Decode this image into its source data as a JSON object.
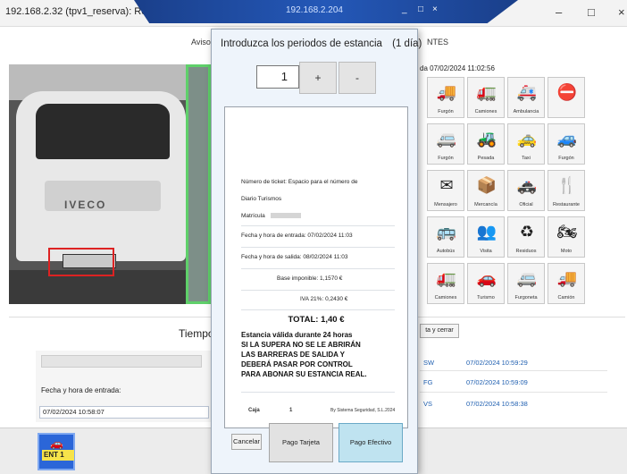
{
  "window": {
    "title": "192.168.2.32 (tpv1_reserva): Re...",
    "remote_ip": "192.168.2.204",
    "remote_min": "_",
    "remote_max": "□",
    "remote_close": "×",
    "min_btn": "–",
    "max_btn": "□",
    "close_btn": "×"
  },
  "top_labels": {
    "aviso": "Aviso",
    "cintes": "NTES"
  },
  "camera": {
    "brand": "IVECO"
  },
  "grid": {
    "date": "da 07/02/2024 11:02:56",
    "buttons": [
      {
        "label": "Furgón",
        "icon": "🚚"
      },
      {
        "label": "Camiones",
        "icon": "🚛"
      },
      {
        "label": "Ambulancia",
        "icon": "🚑"
      },
      {
        "label": "",
        "icon": "⛔"
      },
      {
        "label": "Furgón",
        "icon": "🚐"
      },
      {
        "label": "Pesada",
        "icon": "🚜"
      },
      {
        "label": "Taxi",
        "icon": "🚕"
      },
      {
        "label": "Furgón",
        "icon": "🚙"
      },
      {
        "label": "Mensajero",
        "icon": "✉"
      },
      {
        "label": "Mercancía",
        "icon": "📦"
      },
      {
        "label": "Oficial",
        "icon": "🚓"
      },
      {
        "label": "Restaurante",
        "icon": "🍴"
      },
      {
        "label": "Autobús",
        "icon": "🚌"
      },
      {
        "label": "Visita",
        "icon": "👥"
      },
      {
        "label": "Residuos",
        "icon": "♻"
      },
      {
        "label": "Moto",
        "icon": "🏍"
      },
      {
        "label": "Camiones",
        "icon": "🚛"
      },
      {
        "label": "Turismo",
        "icon": "🚗"
      },
      {
        "label": "Furgoneta",
        "icon": "🚐"
      },
      {
        "label": "Camión",
        "icon": "🚚"
      }
    ]
  },
  "tiempo_label": "Tiempo",
  "cerrar_label": "ta y cerrar",
  "bottom_left": {
    "blur_field": "",
    "entrada_label": "Fecha y hora de entrada:",
    "entrada_value": "07/02/2024 10:58:07"
  },
  "records": [
    {
      "code": "SW",
      "time": "07/02/2024 10:59:29"
    },
    {
      "code": "FG",
      "time": "07/02/2024 10:59:09"
    },
    {
      "code": "VS",
      "time": "07/02/2024 10:58:38"
    }
  ],
  "ent_button": {
    "label": "ENT 1",
    "sub": ""
  },
  "modal": {
    "heading": "Introduzca los periodos de estancia",
    "days": "(1 día)",
    "quantity": "1",
    "plus": "+",
    "minus": "-",
    "ticket": {
      "numero": "Número de ticket:  Espacio para el número de",
      "tipo": "Diario Turismos",
      "matricula": "Matrícula",
      "entrada": "Fecha y hora de entrada:   07/02/2024 11:03",
      "salida": "Fecha y hora de salida:   08/02/2024 11:03",
      "base": "Base imponible:  1,1570 €",
      "iva": "IVA 21%:  0,2430 €",
      "total": "TOTAL: 1,40 €",
      "warn1": "Estancia válida durante 24 horas",
      "warn2": "SI LA SUPERA NO SE LE ABRIRÁN",
      "warn3": "LAS BARRERAS DE SALIDA Y",
      "warn4": "DEBERÁ PASAR POR CONTROL",
      "warn5": "PARA ABONAR SU ESTANCIA REAL.",
      "caja": "Caja",
      "caja_num": "1",
      "footer_right": "By Sistema Seguridad, S.L.2024"
    },
    "cancel": "Cancelar",
    "tarjeta": "Pago Tarjeta",
    "efectivo": "Pago Efectivo"
  }
}
